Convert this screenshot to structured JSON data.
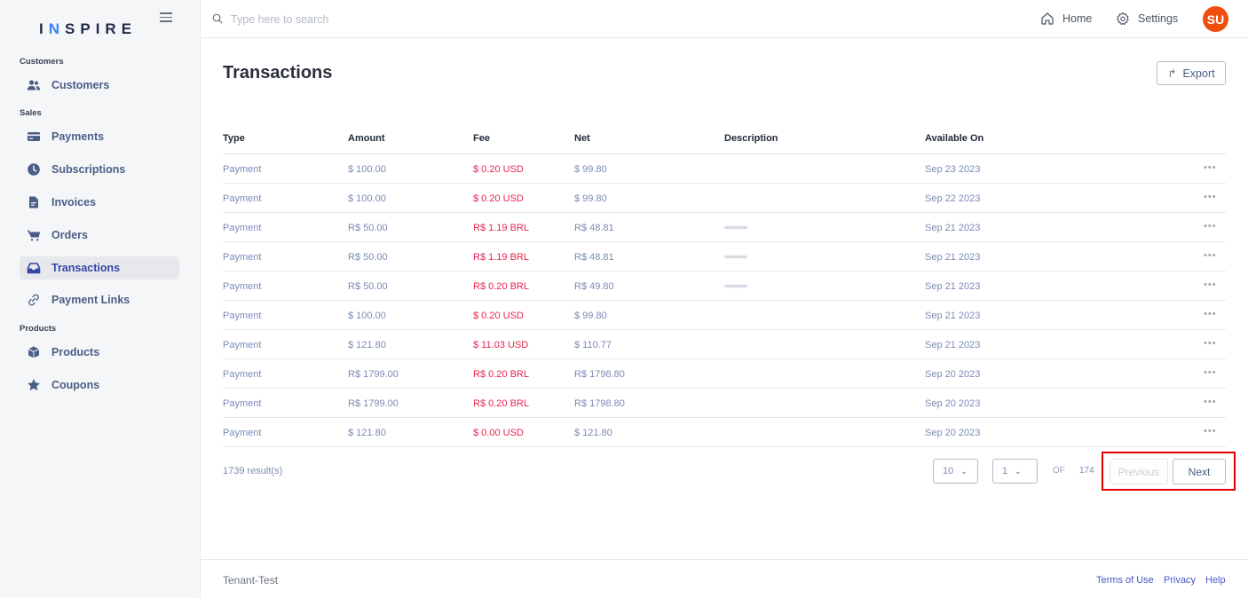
{
  "brand": {
    "pre": "I",
    "accent": "N",
    "post": "SPIRE",
    "color": "#1e2a4a",
    "accent_color": "#3b82f6"
  },
  "sidebar": {
    "sections": [
      "Customers",
      "Sales",
      "Products"
    ],
    "items": [
      {
        "label": "Customers",
        "icon": "users-icon"
      },
      {
        "label": "Payments",
        "icon": "credit-card-icon"
      },
      {
        "label": "Subscriptions",
        "icon": "clock-icon"
      },
      {
        "label": "Invoices",
        "icon": "document-icon"
      },
      {
        "label": "Orders",
        "icon": "cart-icon"
      },
      {
        "label": "Transactions",
        "icon": "inbox-icon",
        "active": true
      },
      {
        "label": "Payment Links",
        "icon": "link-icon"
      },
      {
        "label": "Products",
        "icon": "box-icon"
      },
      {
        "label": "Coupons",
        "icon": "star-icon"
      }
    ]
  },
  "topbar": {
    "search_placeholder": "Type here to search",
    "home_label": "Home",
    "settings_label": "Settings",
    "avatar_initials": "SU",
    "avatar_color": "#f04e0e"
  },
  "main": {
    "title": "Transactions",
    "export_label": "Export"
  },
  "table": {
    "columns": [
      "Type",
      "Amount",
      "Fee",
      "Net",
      "Description",
      "Available On"
    ],
    "rows": [
      {
        "type": "Payment",
        "amount": "$ 100.00",
        "fee": "$ 0.20 USD",
        "net": "$ 99.80",
        "blurred": false,
        "available": "Sep 23 2023"
      },
      {
        "type": "Payment",
        "amount": "$ 100.00",
        "fee": "$ 0.20 USD",
        "net": "$ 99.80",
        "blurred": false,
        "available": "Sep 22 2023"
      },
      {
        "type": "Payment",
        "amount": "R$ 50.00",
        "fee": "R$ 1.19 BRL",
        "net": "R$ 48.81",
        "blurred": true,
        "available": "Sep 21 2023"
      },
      {
        "type": "Payment",
        "amount": "R$ 50.00",
        "fee": "R$ 1.19 BRL",
        "net": "R$ 48.81",
        "blurred": true,
        "available": "Sep 21 2023"
      },
      {
        "type": "Payment",
        "amount": "R$ 50.00",
        "fee": "R$ 0.20 BRL",
        "net": "R$ 49.80",
        "blurred": true,
        "available": "Sep 21 2023"
      },
      {
        "type": "Payment",
        "amount": "$ 100.00",
        "fee": "$ 0.20 USD",
        "net": "$ 99.80",
        "blurred": false,
        "available": "Sep 21 2023"
      },
      {
        "type": "Payment",
        "amount": "$ 121.80",
        "fee": "$ 11.03 USD",
        "net": "$ 110.77",
        "blurred": false,
        "available": "Sep 21 2023"
      },
      {
        "type": "Payment",
        "amount": "R$ 1799.00",
        "fee": "R$ 0.20 BRL",
        "net": "R$ 1798.80",
        "blurred": false,
        "available": "Sep 20 2023"
      },
      {
        "type": "Payment",
        "amount": "R$ 1799.00",
        "fee": "R$ 0.20 BRL",
        "net": "R$ 1798.80",
        "blurred": false,
        "available": "Sep 20 2023"
      },
      {
        "type": "Payment",
        "amount": "$ 121.80",
        "fee": "$ 0.00 USD",
        "net": "$ 121.80",
        "blurred": false,
        "available": "Sep 20 2023"
      }
    ],
    "row_menu": "•••",
    "fee_color": "#e8244e"
  },
  "pagination": {
    "results": "1739 result(s)",
    "page_size": "10",
    "page": "1",
    "of_label": "OF",
    "total_pages": "174",
    "previous_label": "Previous",
    "next_label": "Next"
  },
  "footer": {
    "tenant": "Tenant-Test",
    "links": [
      "Terms of Use",
      "Privacy",
      "Help"
    ]
  }
}
